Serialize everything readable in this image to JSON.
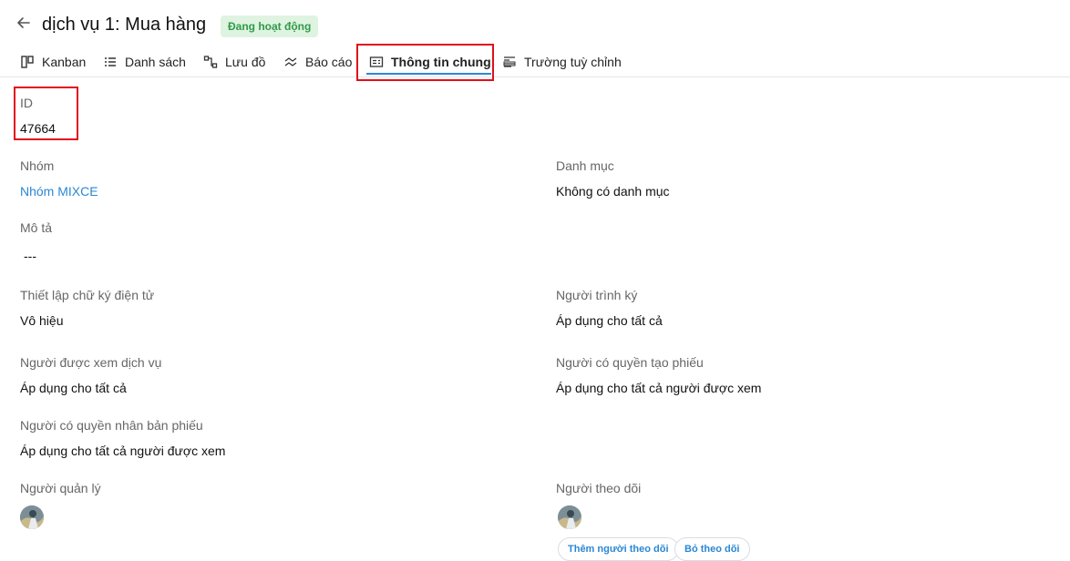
{
  "header": {
    "title": "dịch vụ 1: Mua hàng",
    "status_badge": "Đang hoạt động",
    "back_icon": "arrow-left-icon"
  },
  "tabs": [
    {
      "label": "Kanban",
      "icon": "kanban-icon"
    },
    {
      "label": "Danh sách",
      "icon": "list-icon"
    },
    {
      "label": "Lưu đồ",
      "icon": "flowchart-icon"
    },
    {
      "label": "Báo cáo",
      "icon": "report-icon"
    },
    {
      "label": "Thông tin chung",
      "icon": "info-icon",
      "active": true
    },
    {
      "label": "Trường tuỳ chỉnh",
      "icon": "custom-fields-icon"
    }
  ],
  "fields": {
    "id": {
      "label": "ID",
      "value": "47664"
    },
    "group": {
      "label": "Nhóm",
      "value": "Nhóm MIXCE"
    },
    "category": {
      "label": "Danh mục",
      "value": "Không có danh mục"
    },
    "description": {
      "label": "Mô tả",
      "value": "---"
    },
    "e_signature": {
      "label": "Thiết lập chữ ký điện tử",
      "value": "Vô hiệu"
    },
    "submitter": {
      "label": "Người trình ký",
      "value": "Áp dụng cho tất cả"
    },
    "viewers": {
      "label": "Người được xem dịch vụ",
      "value": "Áp dụng cho tất cả"
    },
    "ticket_creators": {
      "label": "Người có quyền tạo phiếu",
      "value": "Áp dụng cho tất cả người được xem"
    },
    "duplicators": {
      "label": "Người có quyền nhân bản phiếu",
      "value": "Áp dụng cho tất cả người được xem"
    },
    "managers": {
      "label": "Người quản lý"
    },
    "followers": {
      "label": "Người theo dõi"
    }
  },
  "actions": {
    "add_follower": "Thêm người theo dõi",
    "unfollow": "Bỏ theo dõi"
  },
  "colors": {
    "accent": "#2b87d4",
    "badge_bg": "#dff3e1",
    "badge_text": "#2f9b48",
    "highlight": "#e0101a"
  }
}
